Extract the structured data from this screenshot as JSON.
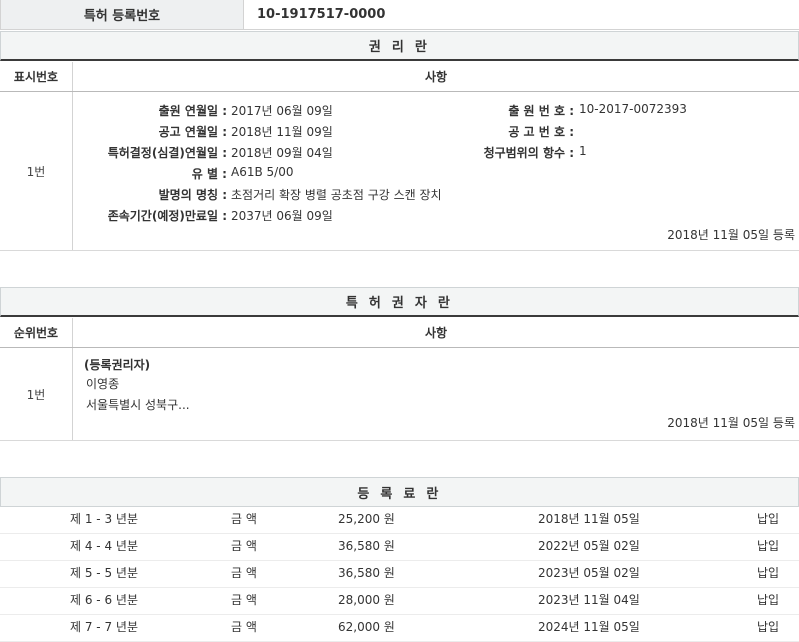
{
  "registration": {
    "label": "특허 등록번호",
    "number": "10-1917517-0000"
  },
  "rights": {
    "title": "권 리 란",
    "col_num": "표시번호",
    "col_matter": "사항",
    "row_num": "1번",
    "fields": {
      "filing_date_label": "출원 연월일 :",
      "filing_date": "2017년 06월 09일",
      "pub_date_label": "공고 연월일 :",
      "pub_date": "2018년 11월 09일",
      "decision_date_label": "특허결정(심결)연월일 :",
      "decision_date": "2018년 09월 04일",
      "class_label": "유 별 :",
      "class": "A61B 5/00",
      "invention_label": "발명의 명칭 :",
      "invention": "초점거리 확장 병렬 공초점 구강 스캔 장치",
      "expiry_label": "존속기간(예정)만료일 :",
      "expiry": "2037년 06월 09일",
      "app_no_label": "출 원 번 호 :",
      "app_no": "10-2017-0072393",
      "pub_no_label": "공 고 번 호 :",
      "pub_no": "",
      "claims_label": "청구범위의 항수 :",
      "claims": "1"
    },
    "registered": "2018년 11월 05일 등록"
  },
  "owner": {
    "title": "특 허 권 자 란",
    "col_num": "순위번호",
    "col_matter": "사항",
    "row_num": "1번",
    "role": "(등록권리자)",
    "name": "이영종",
    "address": "서울특별시 성북구...",
    "registered": "2018년 11월 05일 등록"
  },
  "fees": {
    "title": "등 록 료 란",
    "rows": [
      {
        "period": "제 1 - 3 년분",
        "amount_label": "금 액",
        "amount": "25,200 원",
        "date": "2018년 11월 05일",
        "status": "납입"
      },
      {
        "period": "제 4 - 4 년분",
        "amount_label": "금 액",
        "amount": "36,580 원",
        "date": "2022년 05월 02일",
        "status": "납입"
      },
      {
        "period": "제 5 - 5 년분",
        "amount_label": "금 액",
        "amount": "36,580 원",
        "date": "2023년 05월 02일",
        "status": "납입"
      },
      {
        "period": "제 6 - 6 년분",
        "amount_label": "금 액",
        "amount": "28,000 원",
        "date": "2023년 11월 04일",
        "status": "납입"
      },
      {
        "period": "제 7 - 7 년분",
        "amount_label": "금 액",
        "amount": "62,000 원",
        "date": "2024년 11월 05일",
        "status": "납입"
      }
    ]
  }
}
